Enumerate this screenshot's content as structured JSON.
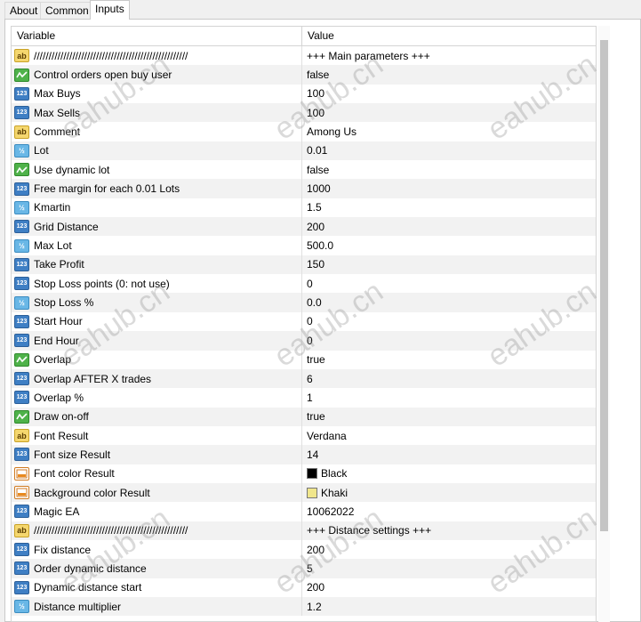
{
  "tabs": [
    {
      "label": "About",
      "active": false
    },
    {
      "label": "Common",
      "active": false
    },
    {
      "label": "Inputs",
      "active": true
    }
  ],
  "columns": {
    "variable": "Variable",
    "value": "Value"
  },
  "rows": [
    {
      "type": "ab",
      "name": "////////////////////////////////////////////////////",
      "value": "+++ Main parameters +++"
    },
    {
      "type": "bool",
      "name": "Control orders open buy user",
      "value": "false"
    },
    {
      "type": "n123",
      "name": "Max Buys",
      "value": "100"
    },
    {
      "type": "n123",
      "name": "Max Sells",
      "value": "100"
    },
    {
      "type": "ab",
      "name": "Comment",
      "value": "Among Us"
    },
    {
      "type": "frac",
      "name": "Lot",
      "value": "0.01"
    },
    {
      "type": "bool",
      "name": "Use dynamic lot",
      "value": "false"
    },
    {
      "type": "n123",
      "name": "Free margin for each 0.01 Lots",
      "value": "1000"
    },
    {
      "type": "frac",
      "name": "Kmartin",
      "value": "1.5"
    },
    {
      "type": "n123",
      "name": "Grid Distance",
      "value": "200"
    },
    {
      "type": "frac",
      "name": "Max Lot",
      "value": "500.0"
    },
    {
      "type": "n123",
      "name": "Take Profit",
      "value": "150"
    },
    {
      "type": "n123",
      "name": "Stop Loss points  (0: not use)",
      "value": "0"
    },
    {
      "type": "frac",
      "name": "Stop Loss %",
      "value": "0.0"
    },
    {
      "type": "n123",
      "name": "Start Hour",
      "value": "0"
    },
    {
      "type": "n123",
      "name": "End Hour",
      "value": "0"
    },
    {
      "type": "bool",
      "name": "Overlap",
      "value": "true"
    },
    {
      "type": "n123",
      "name": "Overlap AFTER X trades",
      "value": "6"
    },
    {
      "type": "n123",
      "name": "Overlap %",
      "value": "1"
    },
    {
      "type": "bool",
      "name": "Draw on-off",
      "value": "true"
    },
    {
      "type": "ab",
      "name": "Font Result",
      "value": "Verdana"
    },
    {
      "type": "n123",
      "name": "Font size Result",
      "value": "14"
    },
    {
      "type": "color",
      "name": "Font color Result",
      "value": "Black",
      "swatch": "#000000"
    },
    {
      "type": "color",
      "name": "Background color Result",
      "value": "Khaki",
      "swatch": "#f0e68c"
    },
    {
      "type": "n123",
      "name": "Magic EA",
      "value": "10062022"
    },
    {
      "type": "ab",
      "name": "////////////////////////////////////////////////////",
      "value": "+++ Distance settings +++"
    },
    {
      "type": "n123",
      "name": "Fix distance",
      "value": "200"
    },
    {
      "type": "n123",
      "name": "Order dynamic distance",
      "value": "5"
    },
    {
      "type": "n123",
      "name": "Dynamic distance start",
      "value": "200"
    },
    {
      "type": "frac",
      "name": "Distance multiplier",
      "value": "1.2"
    }
  ],
  "icon_glyphs": {
    "ab": "ab",
    "n123": "123",
    "frac": "½",
    "bool": "",
    "color": ""
  },
  "watermark": "eahub.cn"
}
